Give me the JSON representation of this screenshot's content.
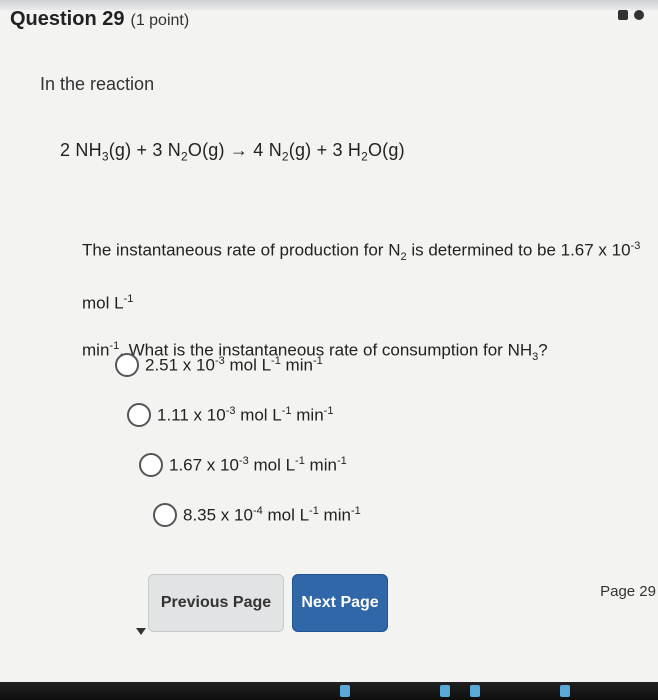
{
  "question": {
    "title": "Question 29",
    "points": "(1 point)",
    "intro": "In the reaction"
  },
  "equation": {
    "c1": "2 NH",
    "s1": "3",
    "p1": "(g) + 3 N",
    "s2": "2",
    "p2": "O(g) → 4 N",
    "s3": "2",
    "p3": "(g) + 3 H",
    "s4": "2",
    "p4": "O(g)"
  },
  "stem": {
    "a": "The instantaneous rate of production for N",
    "a_sub": "2",
    "b": " is determined to be 1.67 x 10",
    "b_sup": "-3",
    "c": " mol L",
    "c_sup": "-1",
    "d": "min",
    "d_sup": "-1",
    "e": ". What is the instantaneous rate of consumption for NH",
    "e_sub": "3",
    "f": "?"
  },
  "options": [
    {
      "mant": "2.51 x 10",
      "exp": "-3",
      "unit": " mol L",
      "u1": "-1",
      "unit2": " min",
      "u2": "-1"
    },
    {
      "mant": "1.11 x 10",
      "exp": "-3",
      "unit": " mol L",
      "u1": "-1",
      "unit2": " min",
      "u2": "-1"
    },
    {
      "mant": "1.67 x 10",
      "exp": "-3",
      "unit": " mol L",
      "u1": "-1",
      "unit2": " min",
      "u2": "-1"
    },
    {
      "mant": "8.35 x 10",
      "exp": "-4",
      "unit": " mol L",
      "u1": "-1",
      "unit2": " min",
      "u2": "-1"
    }
  ],
  "nav": {
    "previous_label": "Previous Page",
    "next_label": "Next Page",
    "page_label": "Page 29"
  },
  "colors": {
    "next_button_bg": "#2f67a8",
    "prev_button_bg": "#e2e3e4"
  }
}
